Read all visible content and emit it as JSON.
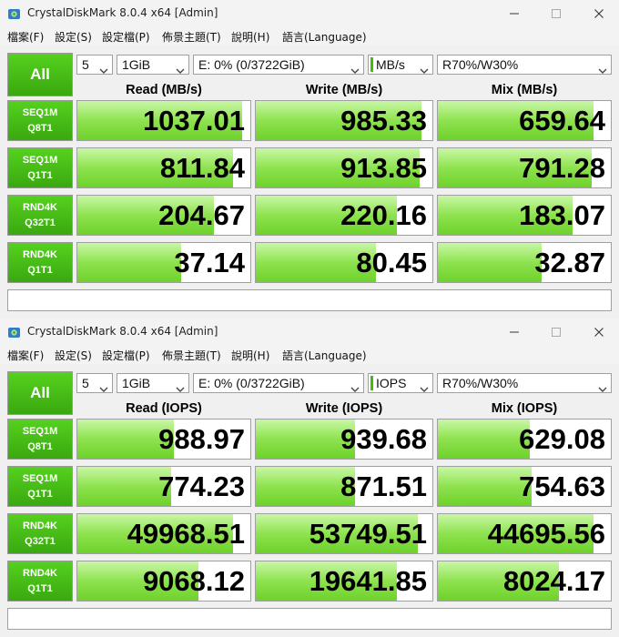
{
  "windows": [
    {
      "title": "CrystalDiskMark 8.0.4 x64 [Admin]",
      "menu": [
        "檔案(F)",
        "設定(S)",
        "設定檔(P)",
        "佈景主題(T)",
        "說明(H)",
        "語言(Language)"
      ],
      "all_label": "All",
      "count": "5",
      "size": "1GiB",
      "drive": "E: 0% (0/3722GiB)",
      "unit": "MB/s",
      "profile": "R70%/W30%",
      "headers": [
        "Read (MB/s)",
        "Write (MB/s)",
        "Mix (MB/s)"
      ],
      "rows": [
        {
          "l1": "SEQ1M",
          "l2": "Q8T1",
          "values": [
            "1037.01",
            "985.33",
            "659.64"
          ],
          "fills": [
            0.95,
            0.94,
            0.9
          ]
        },
        {
          "l1": "SEQ1M",
          "l2": "Q1T1",
          "values": [
            "811.84",
            "913.85",
            "791.28"
          ],
          "fills": [
            0.9,
            0.93,
            0.89
          ]
        },
        {
          "l1": "RND4K",
          "l2": "Q32T1",
          "values": [
            "204.67",
            "220.16",
            "183.07"
          ],
          "fills": [
            0.79,
            0.8,
            0.78
          ]
        },
        {
          "l1": "RND4K",
          "l2": "Q1T1",
          "values": [
            "37.14",
            "80.45",
            "32.87"
          ],
          "fills": [
            0.6,
            0.68,
            0.6
          ]
        }
      ],
      "status": ""
    },
    {
      "title": "CrystalDiskMark 8.0.4 x64 [Admin]",
      "menu": [
        "檔案(F)",
        "設定(S)",
        "設定檔(P)",
        "佈景主題(T)",
        "說明(H)",
        "語言(Language)"
      ],
      "all_label": "All",
      "count": "5",
      "size": "1GiB",
      "drive": "E: 0% (0/3722GiB)",
      "unit": "IOPS",
      "profile": "R70%/W30%",
      "headers": [
        "Read (IOPS)",
        "Write (IOPS)",
        "Mix (IOPS)"
      ],
      "rows": [
        {
          "l1": "SEQ1M",
          "l2": "Q8T1",
          "values": [
            "988.97",
            "939.68",
            "629.08"
          ],
          "fills": [
            0.56,
            0.56,
            0.53
          ]
        },
        {
          "l1": "SEQ1M",
          "l2": "Q1T1",
          "values": [
            "774.23",
            "871.51",
            "754.63"
          ],
          "fills": [
            0.54,
            0.56,
            0.54
          ]
        },
        {
          "l1": "RND4K",
          "l2": "Q32T1",
          "values": [
            "49968.51",
            "53749.51",
            "44695.56"
          ],
          "fills": [
            0.9,
            0.92,
            0.9
          ]
        },
        {
          "l1": "RND4K",
          "l2": "Q1T1",
          "values": [
            "9068.12",
            "19641.85",
            "8024.17"
          ],
          "fills": [
            0.7,
            0.8,
            0.7
          ]
        }
      ],
      "status": ""
    }
  ]
}
